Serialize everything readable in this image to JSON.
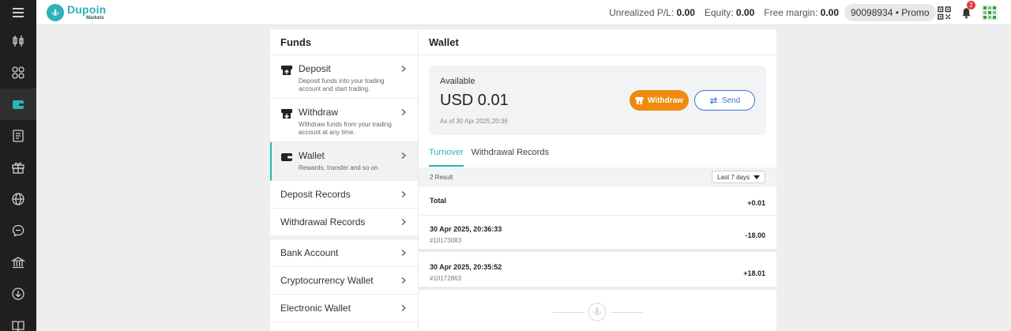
{
  "brand": {
    "name": "Dupoin",
    "sub": "Markets"
  },
  "header": {
    "unrealized_label": "Unrealized P/L:",
    "unrealized_value": "0.00",
    "equity_label": "Equity:",
    "equity_value": "0.00",
    "free_margin_label": "Free margin:",
    "free_margin_value": "0.00",
    "account": "90098934 • Promo",
    "notification_count": "2"
  },
  "sidebar_icons": [
    "chart-candles-icon",
    "apps-grid-icon",
    "wallet-icon",
    "news-icon",
    "gift-icon",
    "globe-icon",
    "chat-icon",
    "bank-icon",
    "download-icon",
    "book-icon"
  ],
  "funds": {
    "title": "Funds",
    "deposit": {
      "label": "Deposit",
      "desc": "Deposit funds into your trading account and start trading."
    },
    "withdraw": {
      "label": "Withdraw",
      "desc": "Withdraw funds from your trading account at any time."
    },
    "wallet": {
      "label": "Wallet",
      "desc": "Rewards, transfer and so on."
    },
    "deposit_records": "Deposit Records",
    "withdrawal_records": "Withdrawal Records",
    "bank_account": "Bank Account",
    "crypto_wallet": "Cryptocurrency Wallet",
    "electronic_wallet": "Electronic Wallet"
  },
  "wallet": {
    "title": "Wallet",
    "available_label": "Available",
    "available_value": "USD 0.01",
    "as_of": "As of 30 Apr 2025,20:36",
    "withdraw_button": "Withdraw",
    "send_button": "Send",
    "tabs": [
      "Turnover",
      "Withdrawal Records"
    ],
    "result_count": "2 Result",
    "filter": "Last 7 days",
    "total_label": "Total",
    "total_value": "+0.01",
    "records": [
      {
        "date": "30 Apr 2025, 20:36:33",
        "id": "#10173083",
        "amount": "-18.00"
      },
      {
        "date": "30 Apr 2025, 20:35:52",
        "id": "#10172863",
        "amount": "+18.01"
      }
    ]
  },
  "colors": {
    "accent": "#2bb3b8",
    "withdraw": "#ef8a0e",
    "send": "#3c76d8",
    "sidebar": "#1f1f1f"
  }
}
